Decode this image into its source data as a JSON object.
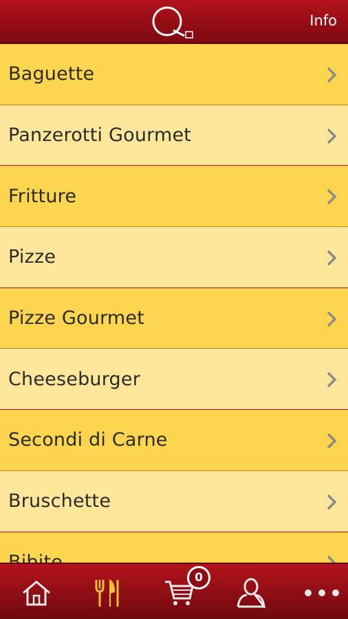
{
  "header": {
    "title_logo": "Q",
    "info_label": "Info"
  },
  "menu": {
    "items": [
      {
        "label": "Baguette"
      },
      {
        "label": "Panzerotti Gourmet"
      },
      {
        "label": "Fritture"
      },
      {
        "label": "Pizze"
      },
      {
        "label": "Pizze Gourmet"
      },
      {
        "label": "Cheeseburger"
      },
      {
        "label": "Secondi di Carne"
      },
      {
        "label": "Bruschette"
      },
      {
        "label": "Bibite"
      }
    ]
  },
  "tabbar": {
    "tabs": [
      {
        "icon": "home-icon"
      },
      {
        "icon": "cutlery-icon",
        "active": true
      },
      {
        "icon": "cart-icon"
      },
      {
        "icon": "user-icon"
      },
      {
        "icon": "more-icon"
      }
    ],
    "cart_count": "0"
  },
  "colors": {
    "header_red": "#a8121a",
    "row_dark": "#fdd54e",
    "row_light": "#fee79b",
    "active_tab": "#f2c230"
  }
}
